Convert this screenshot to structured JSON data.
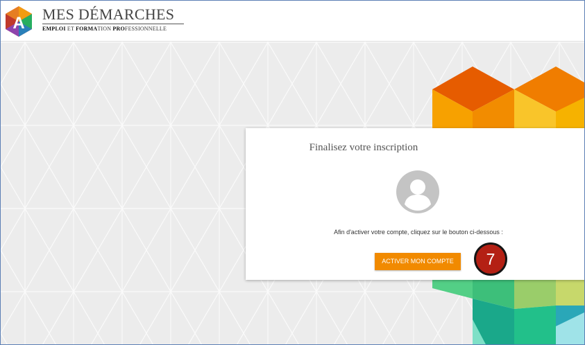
{
  "header": {
    "logo_letter": "A",
    "title": "MES DÉMARCHES",
    "subtitle": {
      "p1": "EMPLOI",
      "p2": " ET ",
      "p3": "FORMA",
      "p4": "TION ",
      "p5": "PRO",
      "p6": "FESSIONNELLE"
    }
  },
  "card": {
    "title": "Finalisez votre inscription",
    "instruction": "Afin d'activer votre compte, cliquez sur le bouton ci-dessous :",
    "button_label": "ACTIVER MON COMPTE"
  },
  "annotation": {
    "step_number": "7"
  },
  "colors": {
    "button": "#f18a00",
    "badge": "#b42014",
    "background": "#ececec"
  },
  "icons": [
    "logo-icon",
    "user-avatar-icon"
  ]
}
